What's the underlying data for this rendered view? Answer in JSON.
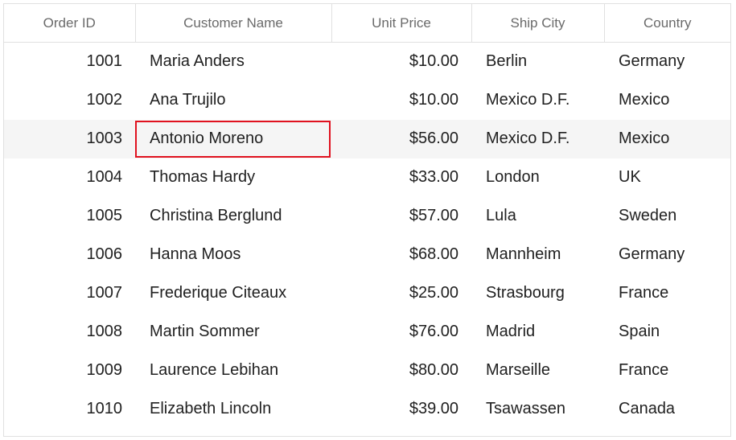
{
  "grid": {
    "columns": [
      "Order ID",
      "Customer Name",
      "Unit Price",
      "Ship City",
      "Country"
    ],
    "rows": [
      {
        "order_id": "1001",
        "customer": "Maria Anders",
        "price": "$10.00",
        "city": "Berlin",
        "country": "Germany"
      },
      {
        "order_id": "1002",
        "customer": "Ana Trujilo",
        "price": "$10.00",
        "city": "Mexico D.F.",
        "country": "Mexico"
      },
      {
        "order_id": "1003",
        "customer": "Antonio Moreno",
        "price": "$56.00",
        "city": "Mexico D.F.",
        "country": "Mexico"
      },
      {
        "order_id": "1004",
        "customer": "Thomas Hardy",
        "price": "$33.00",
        "city": "London",
        "country": "UK"
      },
      {
        "order_id": "1005",
        "customer": "Christina Berglund",
        "price": "$57.00",
        "city": "Lula",
        "country": "Sweden"
      },
      {
        "order_id": "1006",
        "customer": "Hanna Moos",
        "price": "$68.00",
        "city": "Mannheim",
        "country": "Germany"
      },
      {
        "order_id": "1007",
        "customer": "Frederique Citeaux",
        "price": "$25.00",
        "city": "Strasbourg",
        "country": "France"
      },
      {
        "order_id": "1008",
        "customer": "Martin Sommer",
        "price": "$76.00",
        "city": "Madrid",
        "country": "Spain"
      },
      {
        "order_id": "1009",
        "customer": "Laurence Lebihan",
        "price": "$80.00",
        "city": "Marseille",
        "country": "France"
      },
      {
        "order_id": "1010",
        "customer": "Elizabeth Lincoln",
        "price": "$39.00",
        "city": "Tsawassen",
        "country": "Canada"
      }
    ],
    "selected_row": 2,
    "focused_cell": {
      "row": 2,
      "column": "Customer Name"
    },
    "colors": {
      "focus_border": "#e0121f",
      "selected_row_bg": "#f5f5f5",
      "grid_line": "#e0e0e0",
      "header_text": "#6a6a6a"
    }
  }
}
